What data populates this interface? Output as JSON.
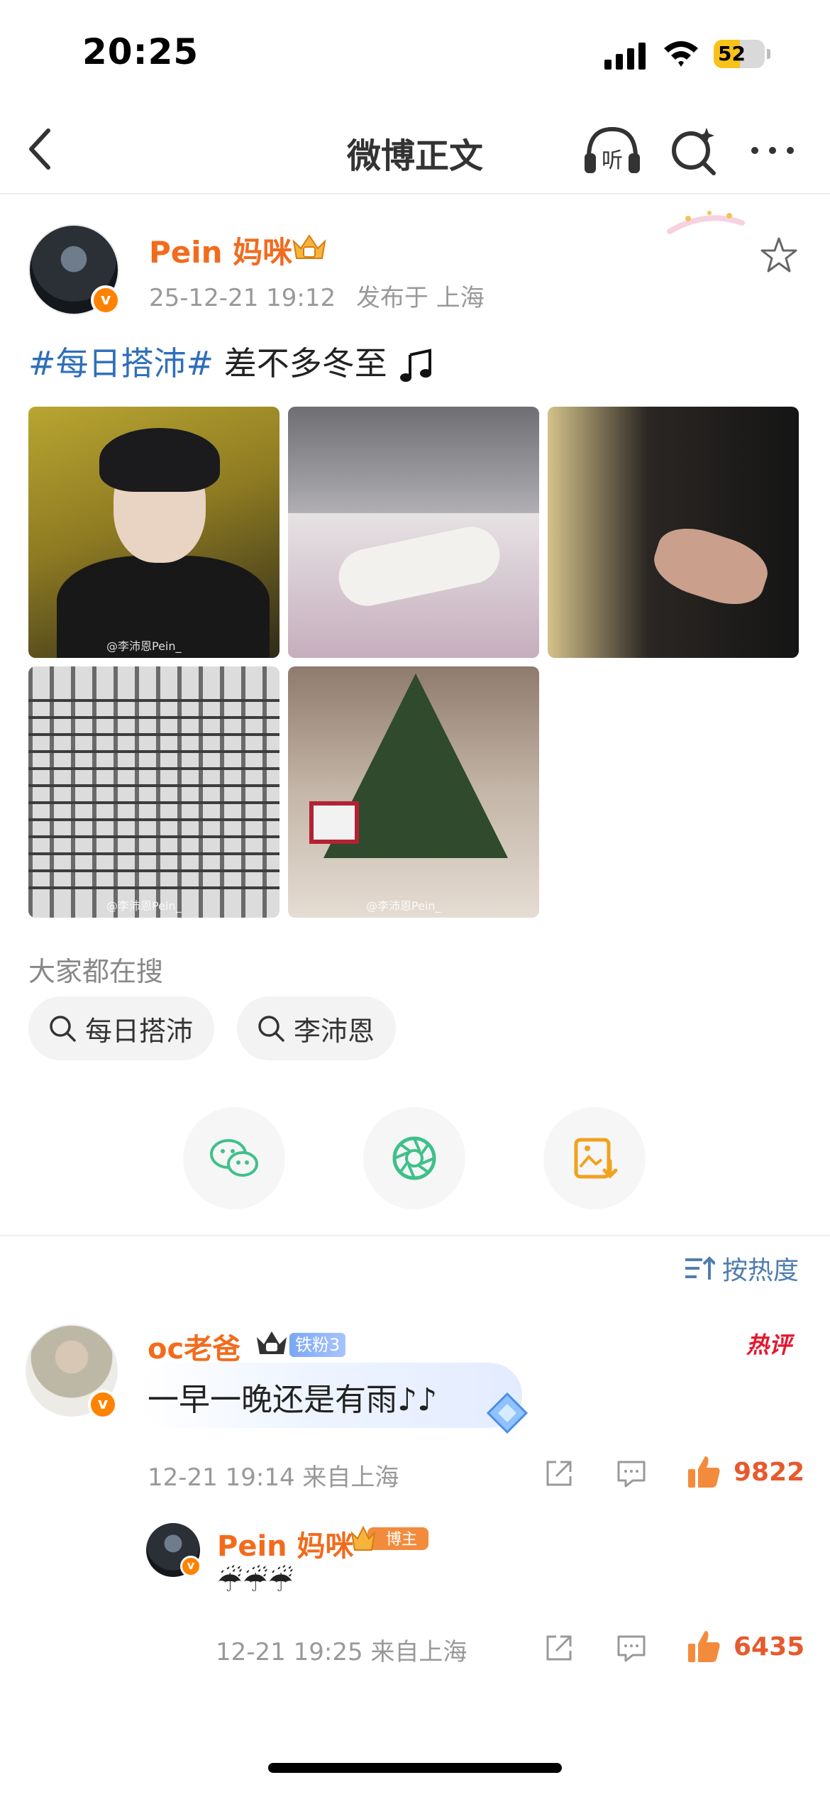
{
  "status_bar": {
    "time": "20:25",
    "battery": "52"
  },
  "nav": {
    "title": "微博正文",
    "listen_label": "听"
  },
  "post": {
    "author": "Pein 妈咪",
    "time": "25-12-21 19:12",
    "location": "发布于 上海",
    "hashtag": "#每日搭沛#",
    "text": " 差不多冬至",
    "watermark1": "@李沛恩Pein_",
    "watermark4": "@李沛恩Pein_",
    "watermark5": "@李沛恩Pein_",
    "image_count": 5
  },
  "search": {
    "label": "大家都在搜",
    "chips": [
      "每日搭沛",
      "李沛恩"
    ]
  },
  "sort": {
    "label": "按热度"
  },
  "comment": {
    "author": "oc老爸",
    "fan_badge": "铁粉3",
    "hot_label": "热评",
    "text": "一早一晚还是有雨♪♪",
    "time": "12-21 19:14",
    "location": "来自上海",
    "likes": "9822"
  },
  "reply": {
    "author": "Pein 妈咪",
    "badge": "博主",
    "text": "☔☔☔",
    "time": "12-21 19:25",
    "location": "来自上海",
    "likes": "6435"
  },
  "colors": {
    "orange_name": "#f26b1d",
    "link_blue": "#2f6fba",
    "like_orange": "#e65a2d",
    "hot_red": "#e6162d"
  }
}
